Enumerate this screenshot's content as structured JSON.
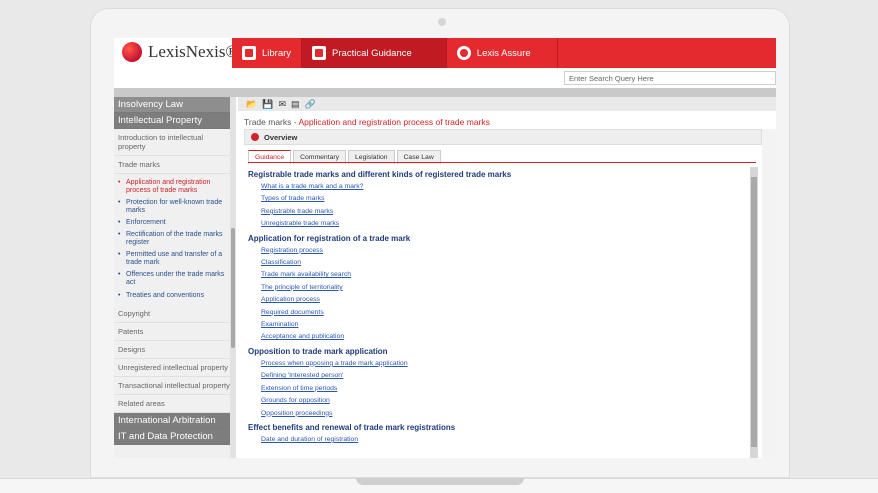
{
  "brand": {
    "name": "LexisNexis®"
  },
  "nav": {
    "tabs": [
      {
        "label": "Library",
        "icon": "book-icon"
      },
      {
        "label": "Practical Guidance",
        "icon": "document-icon"
      },
      {
        "label": "Lexis Assure",
        "icon": "assure-icon"
      }
    ]
  },
  "search": {
    "placeholder": "Enter Search Query Here"
  },
  "sidebar": {
    "headings": [
      "Insolvency Law",
      "Intellectual Property"
    ],
    "subs_top": [
      "Introduction to intellectual property",
      "Trade marks"
    ],
    "bullets": [
      "Application and registration process of trade marks",
      "Protection for well-known trade marks",
      "Enforcement",
      "Rectification of the trade marks register",
      "Permitted use and transfer of a trade mark",
      "Offences under the trade marks act",
      "Treaties and conventions"
    ],
    "subs_bottom": [
      "Copyright",
      "Patents",
      "Designs",
      "Unregistered intellectual property",
      "Transactional intellectual property",
      "Related areas"
    ],
    "headings_bottom": [
      "International Arbitration",
      "IT and Data Protection"
    ]
  },
  "main": {
    "crumb_parent": "Trade marks - ",
    "crumb_current": "Application and registration process of trade marks",
    "overview": "Overview",
    "tabs": [
      "Guidance",
      "Commentary",
      "Legislation",
      "Case Law"
    ],
    "sections": [
      {
        "title": "Registrable trade marks and different kinds of registered trade marks",
        "links": [
          "What is a trade mark and a mark?",
          "Types of trade marks",
          "Registrable trade marks",
          "Unregistrable trade marks"
        ]
      },
      {
        "title": "Application for registration of a trade mark",
        "links": [
          "Registration process",
          "Classification",
          "Trade mark availability search",
          "The principle of territoriality",
          "Application process",
          "Required documents",
          "Examination",
          "Acceptance and publication"
        ]
      },
      {
        "title": "Opposition to trade mark application",
        "links": [
          "Process when opposing a trade mark application",
          "Defining 'Interested person'",
          "Extension of time periods",
          "Grounds for opposition",
          "Opposition proceedings"
        ]
      },
      {
        "title": "Effect benefits and renewal of trade mark registrations",
        "links": [
          "Date and duration of registration"
        ]
      }
    ]
  }
}
